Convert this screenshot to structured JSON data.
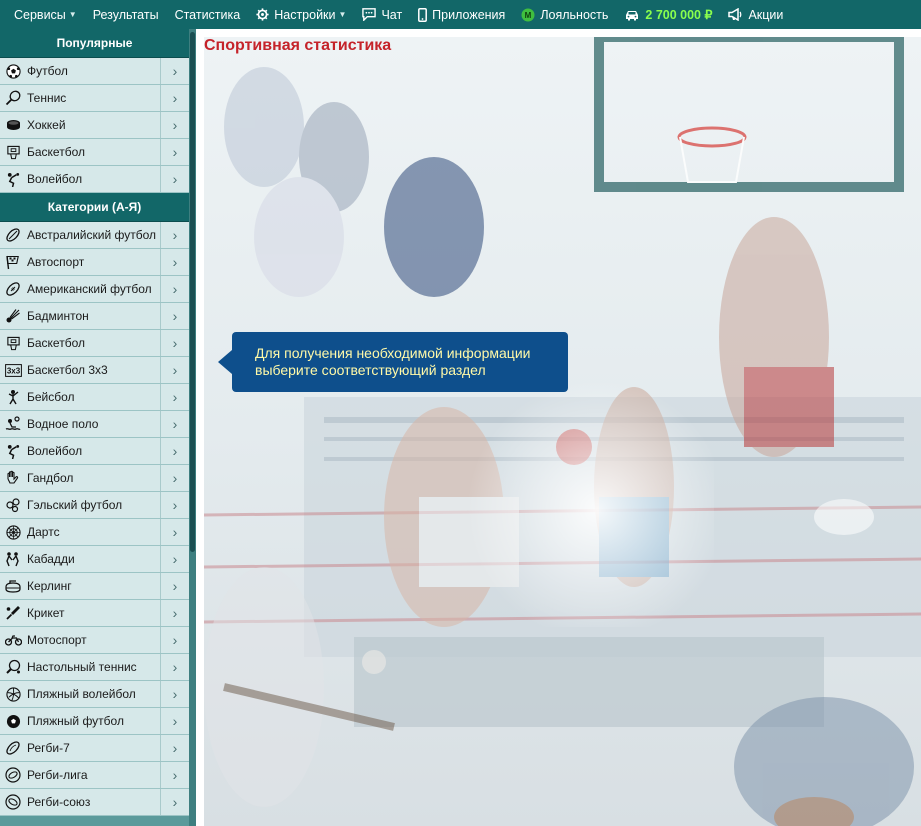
{
  "topnav": {
    "items": [
      {
        "label": "Сервисы",
        "icon": "",
        "has_caret": true
      },
      {
        "label": "Результаты",
        "icon": "",
        "has_caret": false
      },
      {
        "label": "Статистика",
        "icon": "",
        "has_caret": false
      },
      {
        "label": "Настройки",
        "icon": "gear-icon",
        "has_caret": true
      },
      {
        "label": "Чат",
        "icon": "chat-icon",
        "has_caret": false
      },
      {
        "label": "Приложения",
        "icon": "phone-icon",
        "has_caret": false
      },
      {
        "label": "Лояльность",
        "icon": "loyalty-icon",
        "has_caret": false
      },
      {
        "label": "2 700 000 ₽",
        "icon": "car-icon",
        "has_caret": false
      },
      {
        "label": "Акции",
        "icon": "megaphone-icon",
        "has_caret": false
      }
    ]
  },
  "sidebar": {
    "popular_title": "Популярные",
    "popular": [
      {
        "label": "Футбол",
        "icon": "soccer-ball-icon"
      },
      {
        "label": "Теннис",
        "icon": "tennis-racket-icon"
      },
      {
        "label": "Хоккей",
        "icon": "hockey-puck-icon"
      },
      {
        "label": "Баскетбол",
        "icon": "basketball-hoop-icon"
      },
      {
        "label": "Волейбол",
        "icon": "volleyball-player-icon"
      }
    ],
    "categories_title": "Категории (А-Я)",
    "categories": [
      {
        "label": "Австралийский футбол",
        "icon": "aussie-ball-icon"
      },
      {
        "label": "Автоспорт",
        "icon": "race-flag-icon"
      },
      {
        "label": "Американский футбол",
        "icon": "american-football-icon"
      },
      {
        "label": "Бадминтон",
        "icon": "shuttlecock-icon"
      },
      {
        "label": "Баскетбол",
        "icon": "basketball-hoop-icon"
      },
      {
        "label": "Баскетбол 3х3",
        "icon": "basketball-3x3-icon"
      },
      {
        "label": "Бейсбол",
        "icon": "baseball-player-icon"
      },
      {
        "label": "Водное поло",
        "icon": "water-polo-icon"
      },
      {
        "label": "Волейбол",
        "icon": "volleyball-player-icon"
      },
      {
        "label": "Гандбол",
        "icon": "handball-icon"
      },
      {
        "label": "Гэльский футбол",
        "icon": "gaelic-football-icon"
      },
      {
        "label": "Дартс",
        "icon": "dartboard-icon"
      },
      {
        "label": "Кабадди",
        "icon": "kabaddi-icon"
      },
      {
        "label": "Керлинг",
        "icon": "curling-stone-icon"
      },
      {
        "label": "Крикет",
        "icon": "cricket-bat-icon"
      },
      {
        "label": "Мотоспорт",
        "icon": "motorbike-icon"
      },
      {
        "label": "Настольный теннис",
        "icon": "table-tennis-icon"
      },
      {
        "label": "Пляжный волейбол",
        "icon": "beach-volleyball-icon"
      },
      {
        "label": "Пляжный футбол",
        "icon": "beach-soccer-icon"
      },
      {
        "label": "Регби-7",
        "icon": "rugby-ball-icon"
      },
      {
        "label": "Регби-лига",
        "icon": "rugby-league-icon"
      },
      {
        "label": "Регби-союз",
        "icon": "rugby-union-icon"
      }
    ]
  },
  "main": {
    "title": "Спортивная статистика",
    "hint": "Для получения необходимой информации выберите соответствующий раздел"
  },
  "colors": {
    "nav_bg": "#126768",
    "balance": "#8aff4d",
    "title": "#c5232a",
    "tooltip_bg": "#0e4f8c",
    "tooltip_text": "#fff9a8"
  }
}
